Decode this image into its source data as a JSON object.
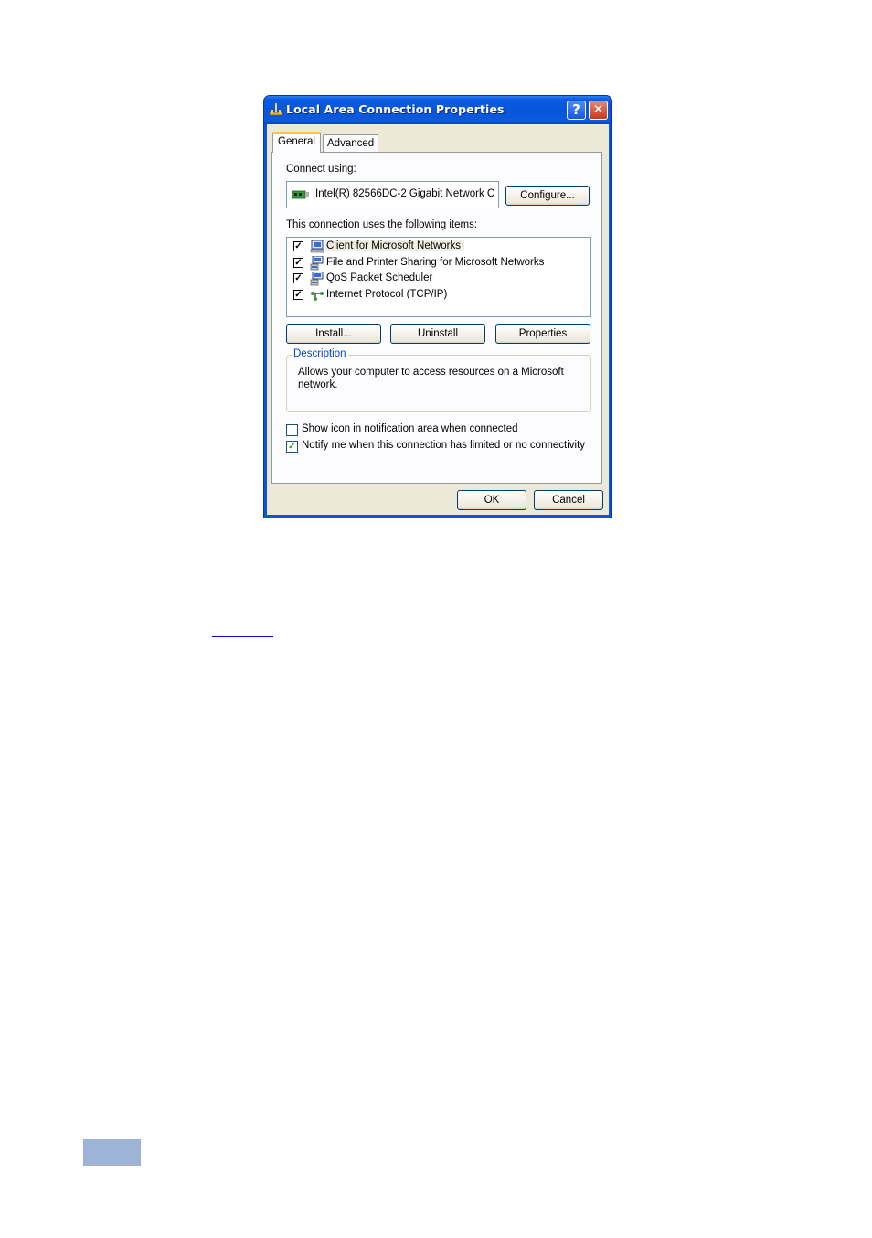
{
  "window": {
    "title": "Local Area Connection Properties",
    "help_label": "?",
    "close_label": "✕",
    "icon": "network-connection-icon"
  },
  "tabs": [
    {
      "label": "General",
      "active": true
    },
    {
      "label": "Advanced",
      "active": false
    }
  ],
  "general": {
    "connect_using_label": "Connect using:",
    "adapter_name": "Intel(R) 82566DC-2 Gigabit Network C",
    "adapter_icon": "network-card-icon",
    "configure_label": "Configure...",
    "items_label": "This connection uses the following items:",
    "items": [
      {
        "label": "Client for Microsoft Networks",
        "checked": true,
        "icon": "network-client-icon",
        "selected": true
      },
      {
        "label": "File and Printer Sharing for Microsoft Networks",
        "checked": true,
        "icon": "network-service-icon",
        "selected": false
      },
      {
        "label": "QoS Packet Scheduler",
        "checked": true,
        "icon": "network-service-icon",
        "selected": false
      },
      {
        "label": "Internet Protocol (TCP/IP)",
        "checked": true,
        "icon": "network-protocol-icon",
        "selected": false
      }
    ],
    "install_label": "Install...",
    "uninstall_label": "Uninstall",
    "properties_label": "Properties",
    "description_title": "Description",
    "description_text": "Allows your computer to access resources on a Microsoft network.",
    "show_icon_label": "Show icon in notification area when connected",
    "show_icon_checked": false,
    "notify_label": "Notify me when this connection has limited or no connectivity",
    "notify_checked": true
  },
  "buttons": {
    "ok_label": "OK",
    "cancel_label": "Cancel"
  },
  "colors": {
    "titlebar": "#0a55d8",
    "dialog_face": "#ece9d8",
    "tab_highlight": "#ffc83c",
    "group_title": "#0046d5",
    "footer_tab": "#9db4d6"
  }
}
